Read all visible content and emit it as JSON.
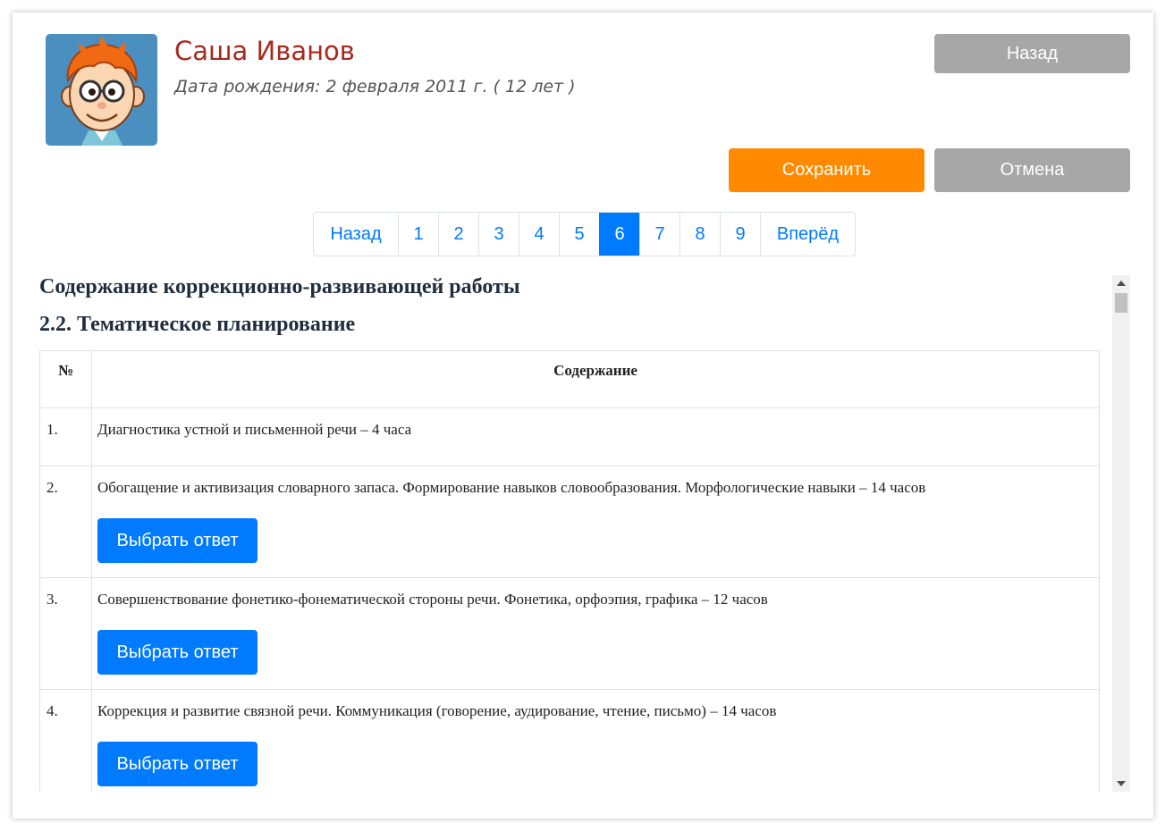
{
  "student": {
    "name": "Саша Иванов",
    "dob": "Дата рождения: 2 февраля 2011 г. ( 12 лет )",
    "avatar_icon": "boy-cartoon-avatar"
  },
  "actions": {
    "back_label": "Назад",
    "save_label": "Сохранить",
    "cancel_label": "Отмена"
  },
  "pagination": {
    "prev_label": "Назад",
    "next_label": "Вперёд",
    "pages": [
      "1",
      "2",
      "3",
      "4",
      "5",
      "6",
      "7",
      "8",
      "9"
    ],
    "active": "6"
  },
  "content": {
    "section_title": "Содержание коррекционно-развивающей работы",
    "subsection_title": "2.2. Тематическое планирование",
    "table_headers": {
      "num": "№",
      "content": "Содержание"
    },
    "rows": [
      {
        "num": "1.",
        "text": "Диагностика устной и письменной речи – 4 часа"
      },
      {
        "num": "2.",
        "text": "Обогащение и активизация словарного запаса. Формирование навыков словообразования. Морфологические навыки – 14 часов",
        "button": "Выбрать ответ"
      },
      {
        "num": "3.",
        "text": "Совершенствование фонетико-фонематической стороны речи. Фонетика, орфоэпия, графика – 12 часов",
        "button": "Выбрать ответ"
      },
      {
        "num": "4.",
        "text": "Коррекция и развитие связной речи. Коммуникация (говорение, аудирование, чтение, письмо) – 14 часов",
        "button": "Выбрать ответ"
      }
    ]
  },
  "colors": {
    "name": "#a8281e",
    "primary": "#007bff",
    "save": "#ff8a00",
    "neutral": "#a7a7a7"
  }
}
